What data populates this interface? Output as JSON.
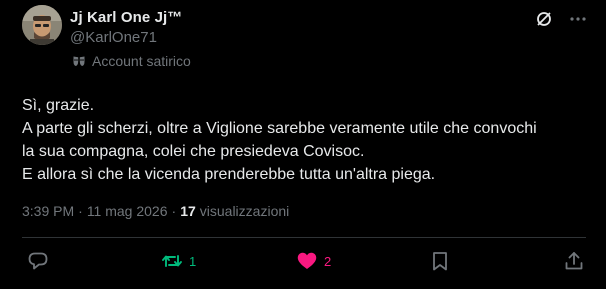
{
  "author": {
    "display_name": "Jj Karl One Jj™",
    "handle": "@KarlOne71",
    "label_text": "Account satirico"
  },
  "tweet": {
    "lines": [
      "Sì, grazie.",
      "A parte gli scherzi, oltre a Viglione sarebbe veramente utile che convochi",
      "la sua compagna, colei che presiedeva Covisoc.",
      "E allora sì che la vicenda prenderebbe tutta un'altra piega."
    ]
  },
  "meta": {
    "time": "3:39 PM",
    "separator": "·",
    "date": "11 mag 2026",
    "views_count": "17",
    "views_label": "visualizzazioni"
  },
  "actions": {
    "replies": "",
    "reposts": "1",
    "likes": "2"
  },
  "colors": {
    "background": "#000000",
    "text": "#e7e9ea",
    "muted": "#71767b",
    "repost_active": "#00ba7c",
    "like_active": "#f91880",
    "divider": "#2f3336"
  },
  "icons": {
    "top_left": "grok-slash-icon",
    "top_right": "more-dots-icon",
    "label": "satire-mask-icon",
    "reply": "reply-bubble-icon",
    "repost": "repost-icon",
    "like": "heart-filled-icon",
    "bookmark": "bookmark-icon",
    "share": "share-icon"
  }
}
